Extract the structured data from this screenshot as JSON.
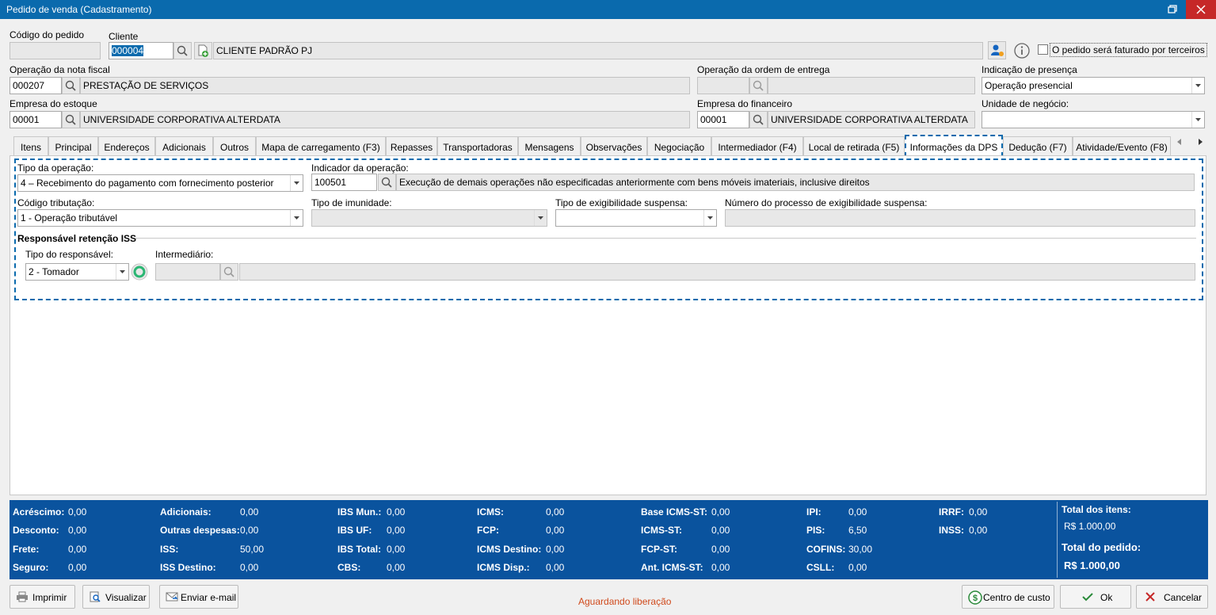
{
  "window": {
    "title": "Pedido de venda (Cadastramento)"
  },
  "header": {
    "codigo_pedido_label": "Código do pedido",
    "codigo_pedido_value": "",
    "cliente_label": "Cliente",
    "cliente_code": "000004",
    "cliente_name": "CLIENTE PADRÃO PJ",
    "terceiros_label": "O pedido será faturado por terceiros",
    "op_nf_label": "Operação da nota fiscal",
    "op_nf_code": "000207",
    "op_nf_name": "PRESTAÇÃO DE SERVIÇOS",
    "op_entrega_label": "Operação da ordem de entrega",
    "op_entrega_code": "",
    "op_entrega_name": "",
    "presenca_label": "Indicação de presença",
    "presenca_value": "Operação presencial",
    "emp_estoque_label": "Empresa do estoque",
    "emp_estoque_code": "00001",
    "emp_estoque_name": "UNIVERSIDADE CORPORATIVA ALTERDATA",
    "emp_fin_label": "Empresa do financeiro",
    "emp_fin_code": "00001",
    "emp_fin_name": "UNIVERSIDADE CORPORATIVA ALTERDATA",
    "unidade_label": "Unidade de negócio:",
    "unidade_value": ""
  },
  "tabs": [
    "Itens",
    "Principal",
    "Endereços",
    "Adicionais",
    "Outros",
    "Mapa de carregamento (F3)",
    "Repasses",
    "Transportadoras",
    "Mensagens",
    "Observações",
    "Negociação",
    "Intermediador (F4)",
    "Local de retirada (F5)",
    "Informações da DPS",
    "Dedução (F7)",
    "Atividade/Evento (F8)"
  ],
  "active_tab": "Informações da DPS",
  "dps": {
    "tipo_operacao_label": "Tipo da operação:",
    "tipo_operacao_value": "4 – Recebimento do pagamento com fornecimento posterior",
    "indicador_label": "Indicador da operação:",
    "indicador_code": "100501",
    "indicador_desc": "Execução de demais operações não especificadas anteriormente com bens móveis imateriais, inclusive direitos",
    "cod_trib_label": "Código tributação:",
    "cod_trib_value": "1 - Operação tributável",
    "imunidade_label": "Tipo de imunidade:",
    "imunidade_value": "",
    "exig_label": "Tipo de exigibilidade suspensa:",
    "exig_value": "",
    "num_proc_label": "Número do processo de exigibilidade suspensa:",
    "num_proc_value": "",
    "iss_section": "Responsável retenção ISS",
    "tipo_resp_label": "Tipo do responsável:",
    "tipo_resp_value": "2 - Tomador",
    "intermediario_label": "Intermediário:",
    "intermediario_code": "",
    "intermediario_name": ""
  },
  "totals": {
    "col1": [
      {
        "label": "Acréscimo:",
        "value": "0,00"
      },
      {
        "label": "Desconto:",
        "value": "0,00"
      },
      {
        "label": "Frete:",
        "value": "0,00"
      },
      {
        "label": "Seguro:",
        "value": "0,00"
      }
    ],
    "col2": [
      {
        "label": "Adicionais:",
        "value": "0,00"
      },
      {
        "label": "Outras despesas:",
        "value": "0,00"
      },
      {
        "label": "ISS:",
        "value": "50,00"
      },
      {
        "label": "ISS Destino:",
        "value": "0,00"
      }
    ],
    "col3": [
      {
        "label": "IBS Mun.:",
        "value": "0,00"
      },
      {
        "label": "IBS UF:",
        "value": "0,00"
      },
      {
        "label": "IBS Total:",
        "value": "0,00"
      },
      {
        "label": "CBS:",
        "value": "0,00"
      }
    ],
    "col4": [
      {
        "label": "ICMS:",
        "value": "0,00"
      },
      {
        "label": "FCP:",
        "value": "0,00"
      },
      {
        "label": "ICMS Destino:",
        "value": "0,00"
      },
      {
        "label": "ICMS Disp.:",
        "value": "0,00"
      }
    ],
    "col5": [
      {
        "label": "Base ICMS-ST:",
        "value": "0,00"
      },
      {
        "label": "ICMS-ST:",
        "value": "0,00"
      },
      {
        "label": "FCP-ST:",
        "value": "0,00"
      },
      {
        "label": "Ant. ICMS-ST:",
        "value": "0,00"
      }
    ],
    "col6": [
      {
        "label": "IPI:",
        "value": "0,00"
      },
      {
        "label": "PIS:",
        "value": "6,50"
      },
      {
        "label": "COFINS:",
        "value": "30,00"
      },
      {
        "label": "CSLL:",
        "value": "0,00"
      }
    ],
    "col7": [
      {
        "label": "IRRF:",
        "value": "0,00"
      },
      {
        "label": "INSS:",
        "value": "0,00"
      }
    ],
    "total_itens_label": "Total dos itens:",
    "total_itens_value": "R$ 1.000,00",
    "total_pedido_label": "Total do pedido:",
    "total_pedido_value": "R$ 1.000,00"
  },
  "buttons": {
    "imprimir": "Imprimir",
    "visualizar": "Visualizar",
    "email": "Enviar e-mail",
    "centro_custo": "Centro de custo",
    "ok": "Ok",
    "cancelar": "Cancelar"
  },
  "status": "Aguardando liberação",
  "colors": {
    "accent": "#0a6aad",
    "footer": "#0a539e",
    "close": "#c62828",
    "status": "#d04a1c"
  }
}
